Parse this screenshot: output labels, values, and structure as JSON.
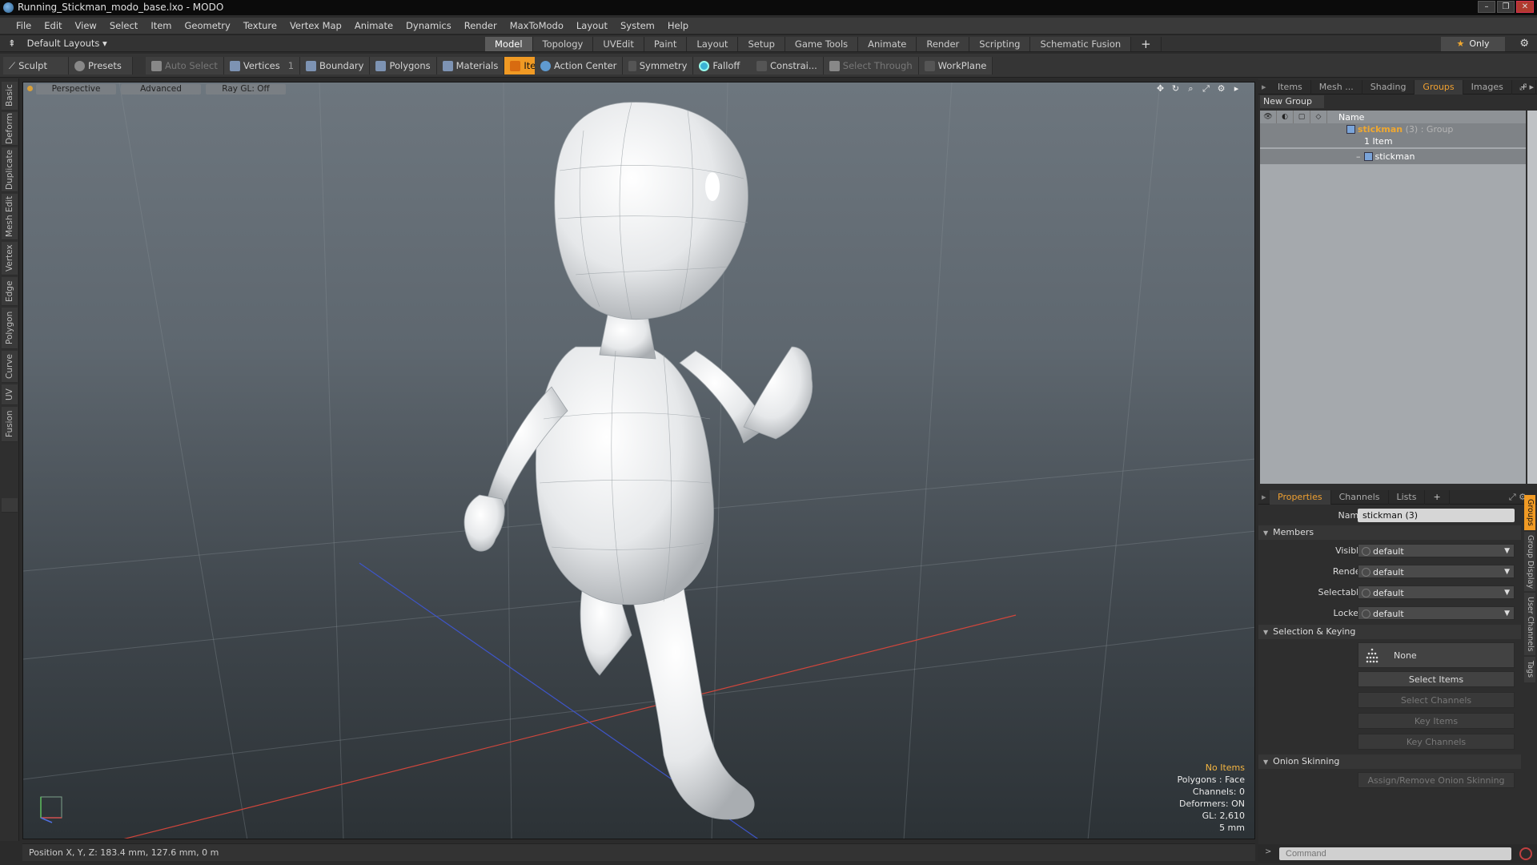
{
  "window": {
    "title": "Running_Stickman_modo_base.lxo - MODO",
    "controls": [
      "–",
      "❐",
      "✕"
    ]
  },
  "menu": [
    "File",
    "Edit",
    "View",
    "Select",
    "Item",
    "Geometry",
    "Texture",
    "Vertex Map",
    "Animate",
    "Dynamics",
    "Render",
    "MaxToModo",
    "Layout",
    "System",
    "Help"
  ],
  "layoutbar": {
    "dropdown_label": "Default Layouts ▾",
    "tabs": [
      "Model",
      "Topology",
      "UVEdit",
      "Paint",
      "Layout",
      "Setup",
      "Game Tools",
      "Animate",
      "Render",
      "Scripting",
      "Schematic Fusion"
    ],
    "active_tab": "Model",
    "add_tab": "+",
    "only_label": "Only"
  },
  "toolbar": {
    "sculpt": "Sculpt",
    "presets": "Presets",
    "auto_select": "Auto Select",
    "vertices": "Vertices",
    "vertices_count": "1",
    "boundary": "Boundary",
    "polygons": "Polygons",
    "materials": "Materials",
    "items": "Items",
    "action_center": "Action Center",
    "symmetry": "Symmetry",
    "falloff": "Falloff",
    "constraints": "Constrai...",
    "select_through": "Select Through",
    "workplane": "WorkPlane"
  },
  "left_tabs": [
    "Basic",
    "Deform",
    "Duplicate",
    "Mesh Edit",
    "Vertex",
    "Edge",
    "Polygon",
    "Curve",
    "UV",
    "Fusion"
  ],
  "viewport": {
    "view_mode": "Perspective",
    "shading": "Advanced",
    "raygl": "Ray GL: Off",
    "icons": [
      "✥",
      "↻",
      "⌕",
      "⤢",
      "⚙",
      "▸"
    ],
    "info": {
      "selection": "No Items",
      "polygons": "Polygons : Face",
      "channels": "Channels: 0",
      "deformers": "Deformers: ON",
      "gl": "GL: 2,610",
      "scale": "5 mm"
    }
  },
  "statusbar": {
    "position": "Position X, Y, Z:   183.4 mm, 127.6 mm, 0 m"
  },
  "groups_panel": {
    "tabs": [
      "Items",
      "Mesh ...",
      "Shading",
      "Groups",
      "Images"
    ],
    "active_tab": "Groups",
    "add": "+",
    "new_group": "New Group",
    "header_name": "Name",
    "rows": [
      {
        "name": "stickman",
        "suffix": "(3) : Group",
        "sub": "1 Item"
      },
      {
        "name": "stickman"
      }
    ]
  },
  "properties_panel": {
    "tabs": [
      "Properties",
      "Channels",
      "Lists"
    ],
    "active_tab": "Properties",
    "add": "+",
    "name_label": "Name",
    "name_value": "stickman (3)",
    "members_section": "Members",
    "members": [
      {
        "label": "Visible",
        "value": "default"
      },
      {
        "label": "Render",
        "value": "default"
      },
      {
        "label": "Selectable",
        "value": "default"
      },
      {
        "label": "Locked",
        "value": "default"
      }
    ],
    "selection_section": "Selection & Keying",
    "none_label": "None",
    "select_items": "Select Items",
    "select_channels": "Select Channels",
    "key_items": "Key Items",
    "key_channels": "Key Channels",
    "onion_section": "Onion Skinning",
    "onion_button": "Assign/Remove Onion Skinning",
    "side_tabs": [
      "Groups",
      "Group Display",
      "User Channels",
      "Tags"
    ]
  },
  "command": {
    "placeholder": "Command"
  },
  "colors": {
    "accent": "#f09a24",
    "viewport_top": "#6d767e",
    "viewport_bottom": "#2c3236"
  }
}
